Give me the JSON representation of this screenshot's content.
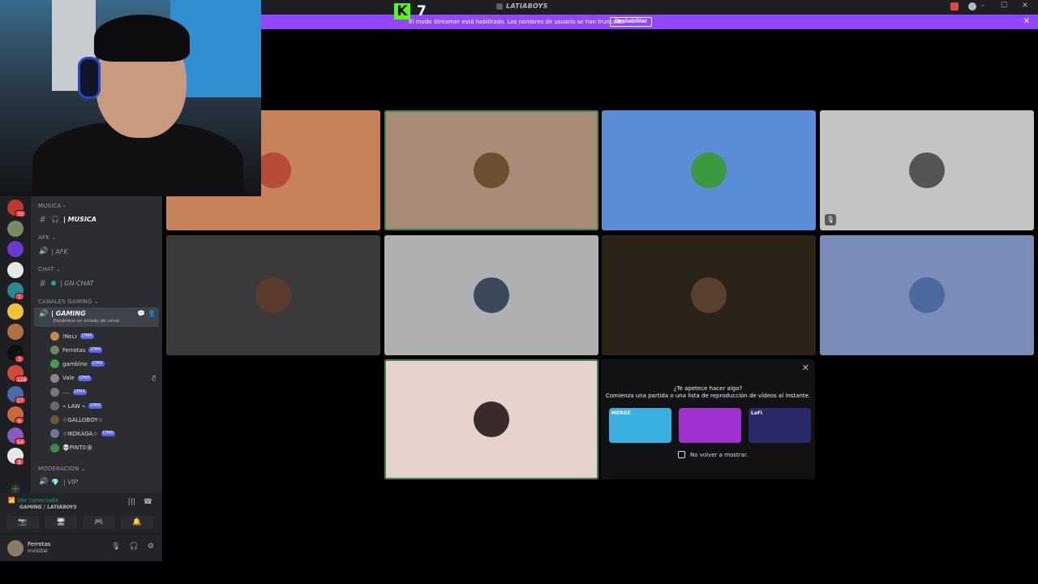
{
  "window": {
    "title": "LATIABOYS",
    "controls": {
      "minimize": "–",
      "maximize": "☐",
      "close": "✕"
    }
  },
  "banner": {
    "text": "El modo Streamer está habilitado. Los nombres de usuario se han truncado.",
    "button": "Deshabilitar",
    "close": "✕"
  },
  "kick": {
    "logo": "K",
    "viewers": "7"
  },
  "servers": [
    {
      "color": "#c0392b",
      "badge": "70"
    },
    {
      "color": "#7a8a60",
      "badge": ""
    },
    {
      "color": "#6a3ad0",
      "badge": ""
    },
    {
      "color": "#e8e8e8",
      "badge": ""
    },
    {
      "color": "#2a8a90",
      "badge": "1"
    },
    {
      "color": "#f0c040",
      "badge": ""
    },
    {
      "color": "#b07040",
      "badge": ""
    },
    {
      "color": "#111111",
      "badge": "3"
    },
    {
      "color": "#d04a3a",
      "badge": "126"
    },
    {
      "color": "#4a6ab0",
      "badge": "27"
    },
    {
      "color": "#c86a3a",
      "badge": "6"
    },
    {
      "color": "#8a5ac0",
      "badge": "54"
    },
    {
      "color": "#e8e8e8",
      "badge": "8"
    }
  ],
  "add_server": "+",
  "channels": {
    "musica_cat": "MUSICA",
    "musica": "| MUSICA",
    "afk_cat": "AFK",
    "afk": "| AFK",
    "chat_cat": "CHAT",
    "gnchat": "| GN-CHAT",
    "gaming_cat": "CANALES GAMING",
    "gaming": "| GAMING",
    "gaming_status": "Establece un estado de canal",
    "moderacion_cat": "MODERACION",
    "vip": "| VIP"
  },
  "voice_users": [
    {
      "name": "!Nᴇʟɪ",
      "tag": "LTMX",
      "color": "#c08a50",
      "muted": false
    },
    {
      "name": "Ferrotas",
      "tag": "LTMX",
      "color": "#6a8a5a",
      "muted": false
    },
    {
      "name": "gambino",
      "tag": "LTMX",
      "color": "#4a9a50",
      "muted": false
    },
    {
      "name": "Vale",
      "tag": "LTMX",
      "color": "#888888",
      "muted": true
    },
    {
      "name": "....",
      "tag": "LTMX",
      "color": "#777777",
      "muted": false
    },
    {
      "name": "⌁ LAW ⌁",
      "tag": "LTMX",
      "color": "#6a6a6a",
      "muted": false
    },
    {
      "name": "☆GALLOBOY☆",
      "tag": "",
      "color": "#6a5a3a",
      "muted": false
    },
    {
      "name": "☆IKOKAGA☆",
      "tag": "LTMX",
      "color": "#6a7a9a",
      "muted": false
    },
    {
      "name": "💀PINT0🕸",
      "tag": "",
      "color": "#3a8a4a",
      "muted": false
    }
  ],
  "voice_panel": {
    "status": "Voz conectada",
    "channel": "GAMING / LATIABOYS"
  },
  "user_panel": {
    "name": "Ferrotas",
    "status": "Invisible"
  },
  "tiles": [
    {
      "bg": "#c8825a",
      "avatar": "#b84a3a",
      "speaking": false,
      "muted": false
    },
    {
      "bg": "#a88c78",
      "avatar": "#6a5030",
      "speaking": true,
      "muted": false
    },
    {
      "bg": "#5b8dd6",
      "avatar": "#3a9a40",
      "speaking": false,
      "muted": false
    },
    {
      "bg": "#c4c4c4",
      "avatar": "#555555",
      "speaking": false,
      "muted": true
    },
    {
      "bg": "#3a3a3a",
      "avatar": "#5a3a2a",
      "speaking": false,
      "muted": false
    },
    {
      "bg": "#b0b0b0",
      "avatar": "#3a4a5a",
      "speaking": false,
      "muted": false
    },
    {
      "bg": "#2a2418",
      "avatar": "#5a4030",
      "speaking": false,
      "muted": false
    },
    {
      "bg": "#7a8cb8",
      "avatar": "#4a6aa0",
      "speaking": false,
      "muted": false
    },
    {
      "bg": "#e6d2cc",
      "avatar": "#3a2a2a",
      "speaking": true,
      "muted": false
    }
  ],
  "activity": {
    "title": "¿Te apetece hacer algo?",
    "subtitle": "Comienza una partida o una lista de reproducción de vídeos al instante.",
    "cards": [
      {
        "label": "MERGE",
        "color": "#3ab0e0"
      },
      {
        "label": "",
        "color": "#a030d0"
      },
      {
        "label": "LoFi",
        "color": "#2a2a6a"
      }
    ],
    "checkbox": "No volver a mostrar.",
    "close": "✕"
  }
}
